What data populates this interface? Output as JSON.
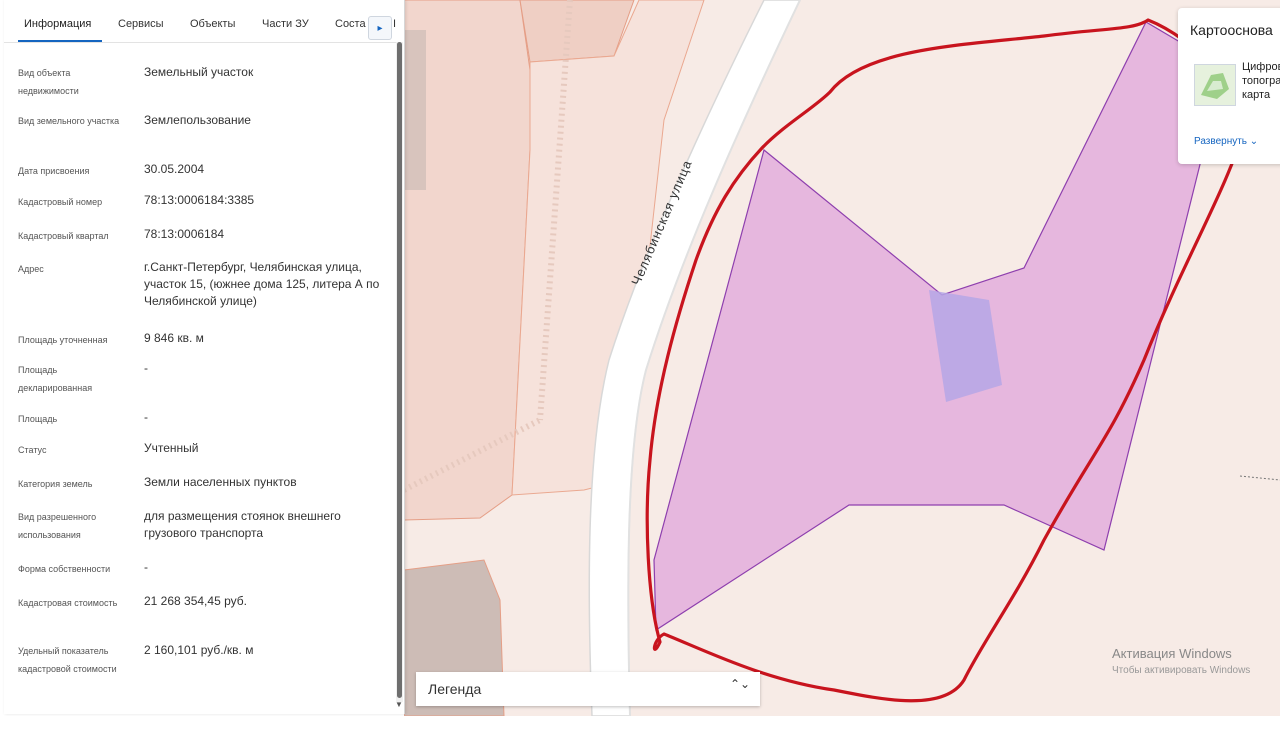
{
  "tabs": [
    {
      "label": "Информация",
      "active": true
    },
    {
      "label": "Сервисы",
      "active": false
    },
    {
      "label": "Объекты",
      "active": false
    },
    {
      "label": "Части ЗУ",
      "active": false
    },
    {
      "label": "Соста",
      "active": false
    }
  ],
  "tabs_arrow": "▸",
  "tabs_edge": "I",
  "info_rows": [
    {
      "label": "Вид объекта недвижимости",
      "value": "Земельный участок"
    },
    {
      "label": "Вид земельного участка",
      "value": "Землепользование"
    },
    {
      "label": "Дата присвоения",
      "value": "30.05.2004"
    },
    {
      "label": "Кадастровый номер",
      "value": "78:13:0006184:3385"
    },
    {
      "label": "Кадастровый квартал",
      "value": "78:13:0006184"
    },
    {
      "label": "Адрес",
      "value": "г.Санкт-Петербург, Челябинская улица, участок 15, (южнее дома 125, литера А по Челябинской улице)"
    },
    {
      "label": "Площадь уточненная",
      "value": "9 846 кв. м"
    },
    {
      "label": "Площадь декларированная",
      "value": "-"
    },
    {
      "label": "Площадь",
      "value": "-"
    },
    {
      "label": "Статус",
      "value": "Учтенный"
    },
    {
      "label": "Категория земель",
      "value": "Земли населенных пунктов"
    },
    {
      "label": "Вид разрешенного использования",
      "value": "для размещения стоянок внешнего грузового транспорта"
    },
    {
      "label": "Форма собственности",
      "value": "-"
    },
    {
      "label": "Кадастровая стоимость",
      "value": "21 268 354,45 руб."
    },
    {
      "label": "Удельный показатель кадастровой стоимости",
      "value": "2 160,101 руб./кв. м"
    }
  ],
  "map": {
    "street_name": "Челябинская улица",
    "legend_label": "Легенда",
    "legend_toggle": "⌃⌄"
  },
  "basemap": {
    "title": "Картооснова",
    "option_label": "Цифровая топографическая карта",
    "expand_label": "Развернуть ⌄"
  },
  "windows_activation": {
    "title": "Активация Windows",
    "subtitle": "Чтобы активировать Windows"
  },
  "colors": {
    "accent": "#1565c0",
    "parcel_fill": "#e6b7de",
    "parcel_stroke": "#8e3fae",
    "annotation_stroke": "#c8141e",
    "map_background": "#f7ebe6"
  }
}
